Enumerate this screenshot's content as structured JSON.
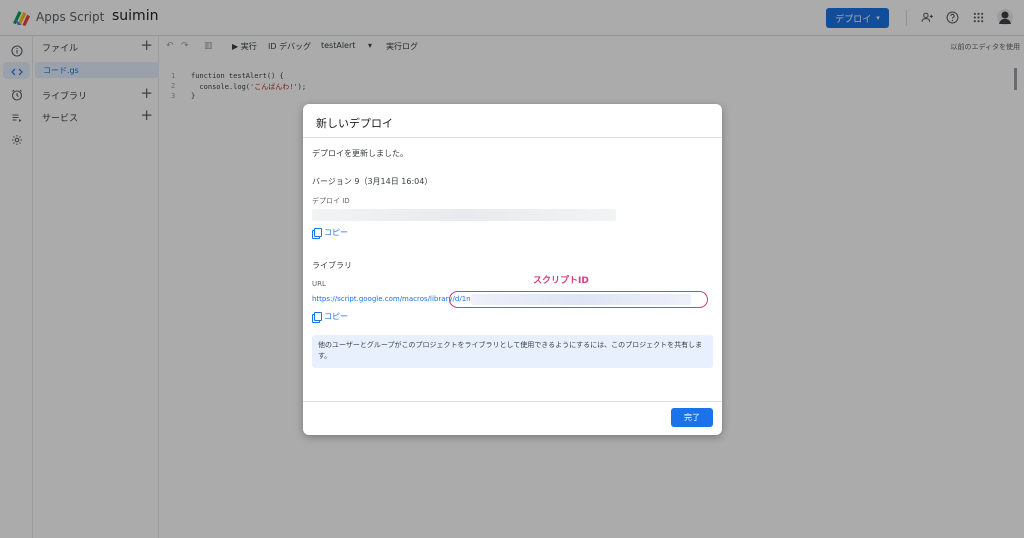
{
  "header": {
    "app_name": "Apps Script",
    "project_name": "suimin",
    "deploy_label": "デプロイ",
    "deploy_caret": "▾",
    "icons": [
      "add-person-icon",
      "help-icon",
      "apps-grid-icon",
      "avatar"
    ]
  },
  "rail": {
    "icons": [
      "info-icon",
      "code-icon",
      "clock-icon",
      "executions-icon",
      "gear-icon"
    ]
  },
  "files": {
    "section_files": "ファイル",
    "file_name": "コード.gs",
    "section_libraries": "ライブラリ",
    "section_services": "サービス",
    "plus": "+"
  },
  "toolbar": {
    "undo": "↶",
    "redo": "↷",
    "save_icon": "▥",
    "run": "▶ 実行",
    "debug": "ID デバッグ",
    "function_name": "testAlert",
    "function_caret": "▾",
    "log": "実行ログ",
    "legacy_editor": "以前のエディタを使用"
  },
  "editor": {
    "lines": [
      {
        "num": "1",
        "pre": "function testAlert() {",
        "str": "",
        "post": ""
      },
      {
        "num": "2",
        "pre": "  console.log(",
        "str": "'こんばんわ!'",
        "post": ");"
      },
      {
        "num": "3",
        "pre": "}",
        "str": "",
        "post": ""
      }
    ]
  },
  "dialog": {
    "title": "新しいデプロイ",
    "updated_message": "デプロイを更新しました。",
    "version_line": "バージョン 9（3月14日 16:04）",
    "deploy_id_label": "デプロイ ID",
    "copy_label": "コピー",
    "library_heading": "ライブラリ",
    "url_label": "URL",
    "url_value": "https://script.google.com/macros/library/d/1nBi",
    "script_id_annotation": "スクリプトID",
    "info_text": "他のユーザーとグループがこのプロジェクトをライブラリとして使用できるようにするには、このプロジェクトを共有します。",
    "done_label": "完了"
  },
  "colors": {
    "accent": "#1a73e8",
    "annotation": "#d23f7a",
    "info_bg": "#e8f0fe"
  }
}
